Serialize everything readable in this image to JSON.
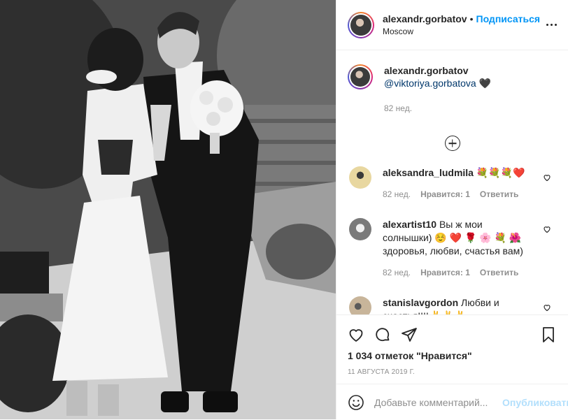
{
  "post": {
    "username": "alexandr.gorbatov",
    "follow_label": "Подписаться",
    "location": "Moscow",
    "caption_username": "alexandr.gorbatov",
    "caption_mention": "@viktoriya.gorbatova",
    "caption_emoji": "🖤",
    "caption_time": "82 нед."
  },
  "comments": [
    {
      "username": "aleksandra_ludmila",
      "text": "💐💐💐❤️",
      "time": "82 нед.",
      "likes": "Нравится: 1",
      "reply": "Ответить",
      "avatar_color": "#e8d7a0"
    },
    {
      "username": "alexartist10",
      "text": "Вы ж мои солнышки) ☺️ ❤️ 🌹 🌸 💐 🌺 здоровья, любви, счастья вам)",
      "time": "82 нед.",
      "likes": "Нравится: 1",
      "reply": "Ответить",
      "avatar_color": "#9a9a9a"
    },
    {
      "username": "stanislavgordon",
      "text": "Любви и счастья!!!!✌️✌️✌️",
      "avatar_color": "#c8b59a"
    }
  ],
  "footer": {
    "likes": "1 034 отметок \"Нравится\"",
    "date": "11 АВГУСТА 2019 Г.",
    "comment_placeholder": "Добавьте комментарий...",
    "publish_label": "Опубликовать"
  },
  "icons": {
    "heart": "heart-icon",
    "comment": "comment-icon",
    "share": "share-icon",
    "bookmark": "bookmark-icon",
    "emoji": "emoji-icon",
    "more": "more-icon",
    "add": "plus-circle-icon"
  },
  "colors": {
    "accent": "#0095f6",
    "publish_disabled": "#b2dffc",
    "muted": "#8e8e8e"
  }
}
